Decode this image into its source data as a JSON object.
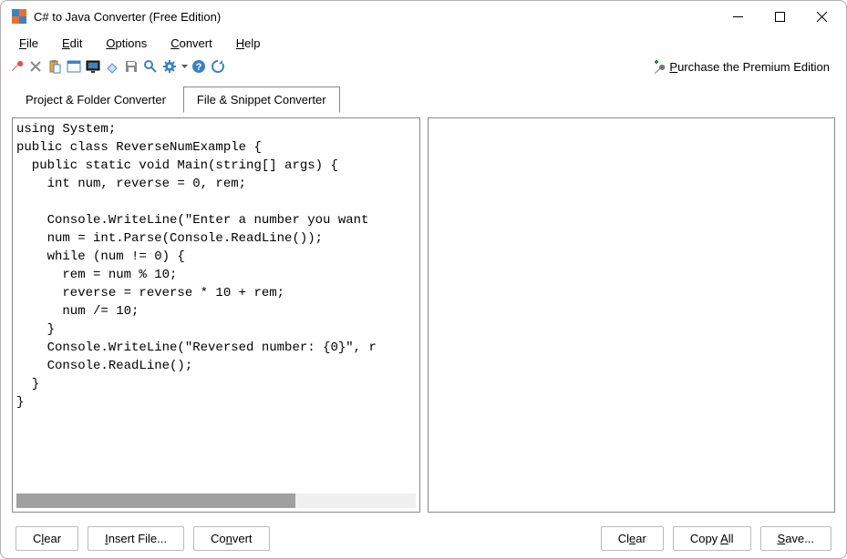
{
  "titlebar": {
    "title": "C# to Java Converter (Free Edition)"
  },
  "menu": {
    "file": "File",
    "edit": "Edit",
    "options": "Options",
    "convert": "Convert",
    "help": "Help"
  },
  "premium": {
    "label": "Purchase the Premium Edition"
  },
  "tabs": {
    "project": "Project & Folder Converter",
    "snippet": "File & Snippet Converter"
  },
  "code": "using System;\npublic class ReverseNumExample {\n  public static void Main(string[] args) {\n    int num, reverse = 0, rem;\n\n    Console.WriteLine(\"Enter a number you want \n    num = int.Parse(Console.ReadLine());\n    while (num != 0) {\n      rem = num % 10;\n      reverse = reverse * 10 + rem;\n      num /= 10;\n    }\n    Console.WriteLine(\"Reversed number: {0}\", r\n    Console.ReadLine();\n  }\n}",
  "buttons": {
    "clear_left": "Clear",
    "insert_file": "Insert File...",
    "convert": "Convert",
    "clear_right": "Clear",
    "copy_all": "Copy All",
    "save": "Save..."
  }
}
